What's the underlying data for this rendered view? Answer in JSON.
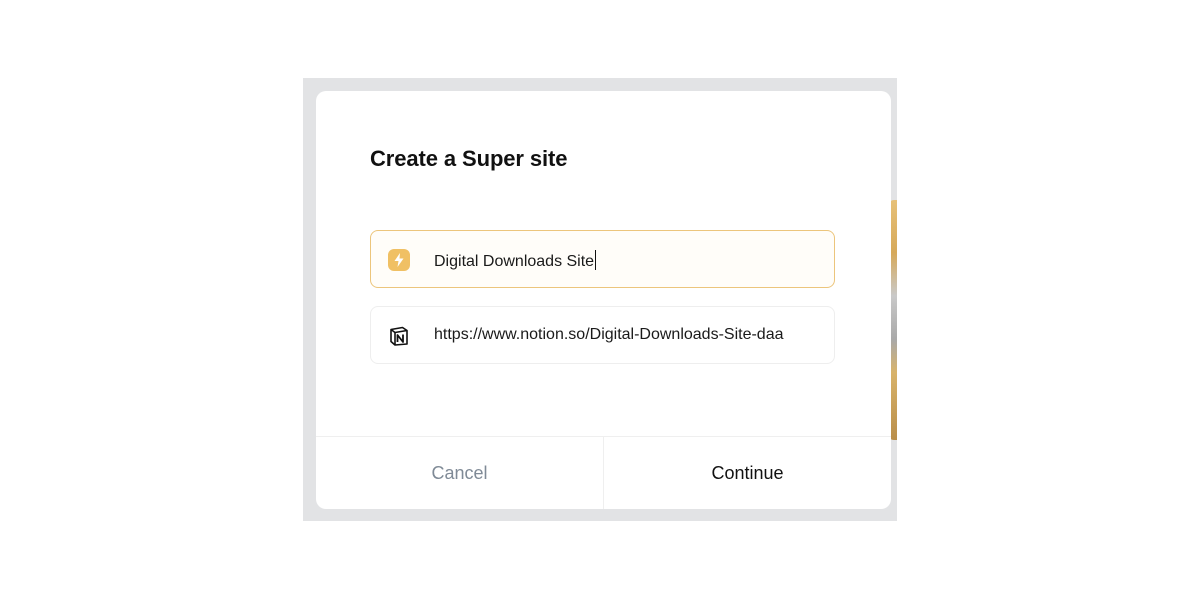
{
  "dialog": {
    "title": "Create a Super site",
    "site_name_field": {
      "value": "Digital Downloads Site",
      "icon": "bolt-icon",
      "focused": true,
      "accent_color": "#F0C064"
    },
    "notion_url_field": {
      "value": "https://www.notion.so/Digital-Downloads-Site-daa",
      "icon": "notion-logo-icon"
    },
    "cancel_label": "Cancel",
    "continue_label": "Continue"
  }
}
